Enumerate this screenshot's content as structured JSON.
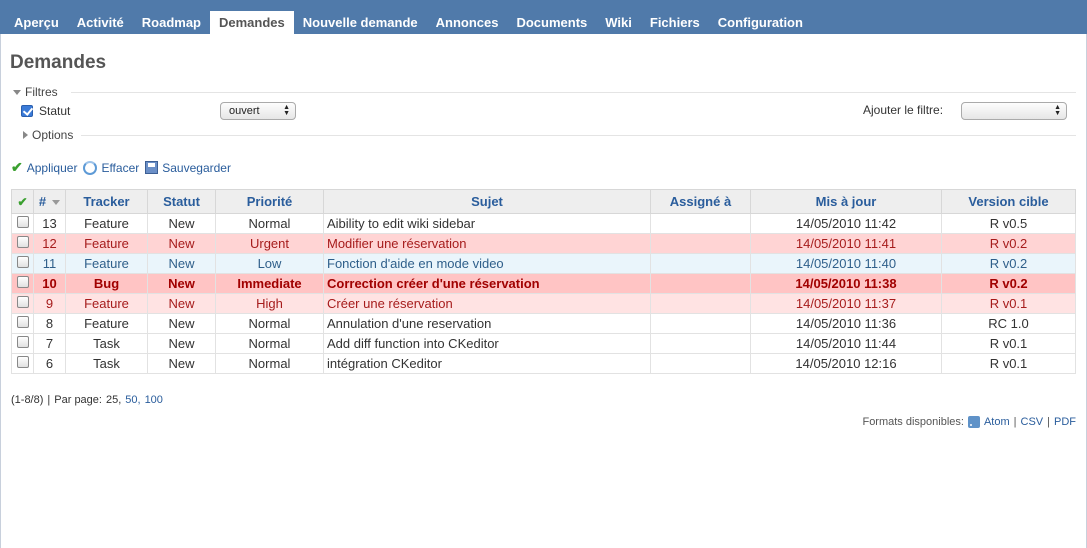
{
  "tabs": [
    "Aperçu",
    "Activité",
    "Roadmap",
    "Demandes",
    "Nouvelle demande",
    "Annonces",
    "Documents",
    "Wiki",
    "Fichiers",
    "Configuration"
  ],
  "active_tab": "Demandes",
  "page_title": "Demandes",
  "filters": {
    "legend": "Filtres",
    "status_label": "Statut",
    "status_value": "ouvert",
    "add_filter_label": "Ajouter le filtre:",
    "add_filter_value": ""
  },
  "options": {
    "legend": "Options"
  },
  "actions": {
    "apply": "Appliquer",
    "clear": "Effacer",
    "save": "Sauvegarder"
  },
  "table": {
    "columns": {
      "id": "#",
      "tracker": "Tracker",
      "status": "Statut",
      "priority": "Priorité",
      "subject": "Sujet",
      "assignee": "Assigné à",
      "updated": "Mis à jour",
      "version": "Version cible"
    },
    "rows": [
      {
        "id": "13",
        "tracker": "Feature",
        "status": "New",
        "priority": "Normal",
        "subject": "Aibility to edit wiki sidebar",
        "assignee": "",
        "updated": "14/05/2010 11:42",
        "version": "R v0.5",
        "style": "normal"
      },
      {
        "id": "12",
        "tracker": "Feature",
        "status": "New",
        "priority": "Urgent",
        "subject": "Modifier une réservation",
        "assignee": "",
        "updated": "14/05/2010 11:41",
        "version": "R v0.2",
        "style": "urgent"
      },
      {
        "id": "11",
        "tracker": "Feature",
        "status": "New",
        "priority": "Low",
        "subject": "Fonction d'aide en mode video",
        "assignee": "",
        "updated": "14/05/2010 11:40",
        "version": "R v0.2",
        "style": "low"
      },
      {
        "id": "10",
        "tracker": "Bug",
        "status": "New",
        "priority": "Immediate",
        "subject": "Correction créer d'une réservation",
        "assignee": "",
        "updated": "14/05/2010 11:38",
        "version": "R v0.2",
        "style": "immediate"
      },
      {
        "id": "9",
        "tracker": "Feature",
        "status": "New",
        "priority": "High",
        "subject": "Créer une réservation",
        "assignee": "",
        "updated": "14/05/2010 11:37",
        "version": "R v0.1",
        "style": "high"
      },
      {
        "id": "8",
        "tracker": "Feature",
        "status": "New",
        "priority": "Normal",
        "subject": "Annulation d'une reservation",
        "assignee": "",
        "updated": "14/05/2010 11:36",
        "version": "RC 1.0",
        "style": "normal"
      },
      {
        "id": "7",
        "tracker": "Task",
        "status": "New",
        "priority": "Normal",
        "subject": "Add diff function into CKeditor",
        "assignee": "",
        "updated": "14/05/2010 11:44",
        "version": "R v0.1",
        "style": "normal"
      },
      {
        "id": "6",
        "tracker": "Task",
        "status": "New",
        "priority": "Normal",
        "subject": "intégration CKeditor",
        "assignee": "",
        "updated": "14/05/2010 12:16",
        "version": "R v0.1",
        "style": "normal"
      }
    ]
  },
  "pagination": {
    "range": "(1-8/8)",
    "sep": "|",
    "per_page_label": "Par page:",
    "current": "25,",
    "option_50": "50,",
    "option_100": "100"
  },
  "formats": {
    "label": "Formats disponibles:",
    "atom": "Atom",
    "csv": "CSV",
    "pdf": "PDF",
    "sep": "|"
  },
  "colors": {
    "topbar": "#507aaa",
    "link": "#2a5d9c",
    "urgent_row": "#ffd4d4",
    "immediate_row": "#ffc4c4",
    "high_row": "#ffe3e3",
    "low_row": "#eaf5fb"
  }
}
